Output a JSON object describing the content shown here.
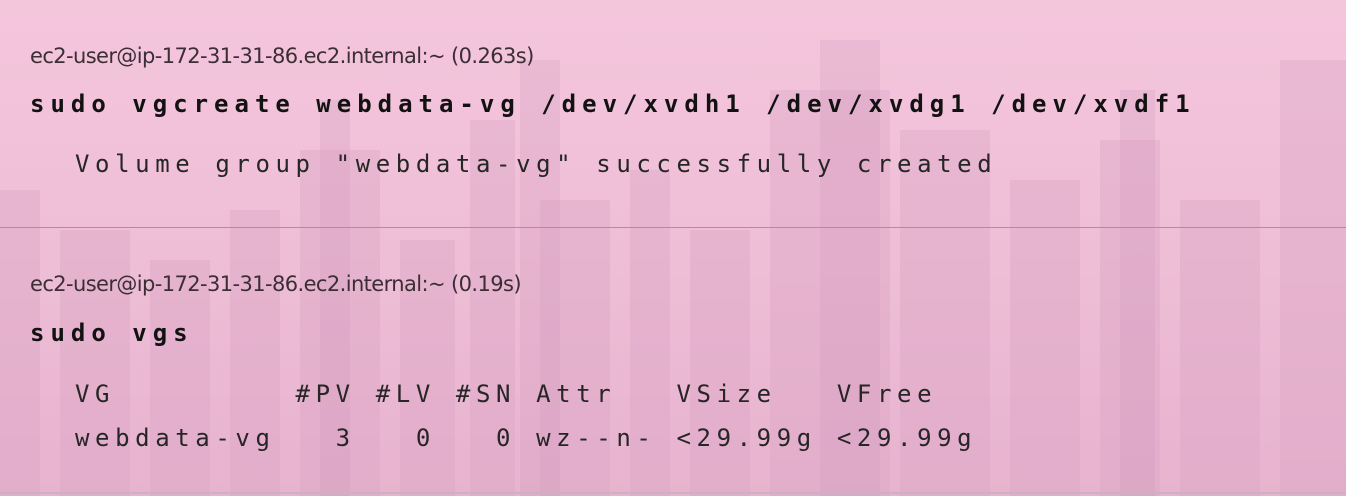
{
  "blocks": [
    {
      "prompt": "ec2-user@ip-172-31-31-86.ec2.internal:~ (0.263s)",
      "command": "sudo vgcreate webdata-vg /dev/xvdh1 /dev/xvdg1 /dev/xvdf1",
      "output": [
        "Volume group \"webdata-vg\" successfully created"
      ]
    },
    {
      "prompt": "ec2-user@ip-172-31-31-86.ec2.internal:~ (0.19s)",
      "command": "sudo vgs",
      "output": [
        "VG         #PV #LV #SN Attr   VSize   VFree",
        "webdata-vg   3   0   0 wz--n- <29.99g <29.99g"
      ]
    }
  ],
  "colors": {
    "background": "#f4c6dc",
    "prompt_text": "#3b2e35",
    "command_text": "#121212",
    "output_text": "#262626",
    "divider": "#a8919e"
  }
}
